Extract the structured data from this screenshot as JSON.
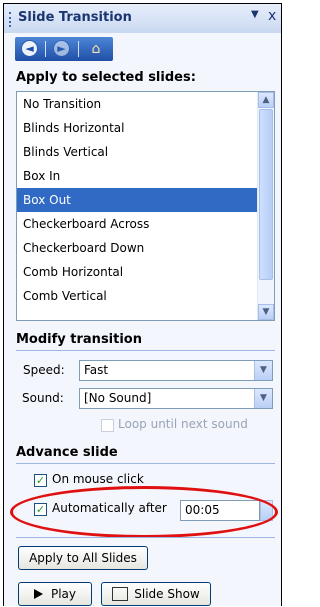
{
  "pane": {
    "title": "Slide Transition",
    "dropdown_glyph": "▼",
    "close_glyph": "x"
  },
  "nav": {
    "back_glyph": "◄",
    "forward_glyph": "►",
    "home_glyph": "⌂"
  },
  "apply_section": {
    "heading": "Apply to selected slides:",
    "items": [
      {
        "label": "No Transition"
      },
      {
        "label": "Blinds Horizontal"
      },
      {
        "label": "Blinds Vertical"
      },
      {
        "label": "Box In"
      },
      {
        "label": "Box Out"
      },
      {
        "label": "Checkerboard Across"
      },
      {
        "label": "Checkerboard Down"
      },
      {
        "label": "Comb Horizontal"
      },
      {
        "label": "Comb Vertical"
      }
    ],
    "selected_index": 4
  },
  "modify_section": {
    "heading": "Modify transition",
    "speed_label": "Speed:",
    "speed_value": "Fast",
    "sound_label": "Sound:",
    "sound_value": "[No Sound]",
    "loop_label": "Loop until next sound",
    "loop_checked": false
  },
  "advance_section": {
    "heading": "Advance slide",
    "on_click_label": "On mouse click",
    "on_click_checked": true,
    "auto_label": "Automatically after",
    "auto_checked": true,
    "auto_time": "00:05"
  },
  "buttons": {
    "apply_all": "Apply to All Slides",
    "play": "Play",
    "slideshow": "Slide Show"
  },
  "colors": {
    "selection": "#316ac5",
    "highlight_ellipse": "#e01010"
  }
}
